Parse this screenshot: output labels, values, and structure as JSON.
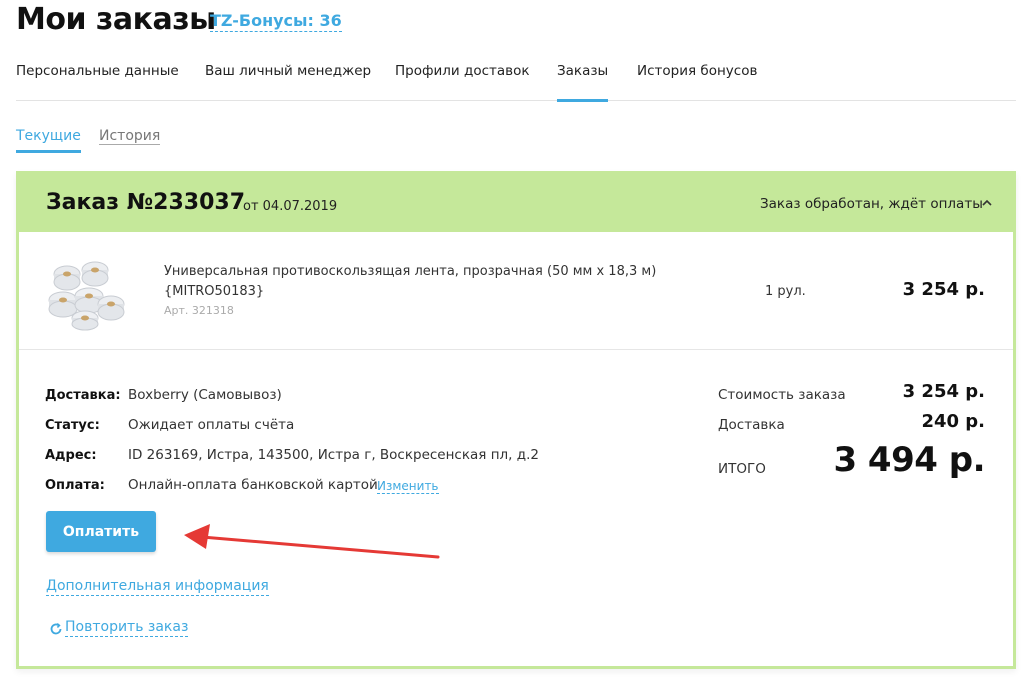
{
  "header": {
    "title": "Мои заказы",
    "bonus_link": "TZ-Бонусы: 36"
  },
  "main_tabs": [
    {
      "label": "Персональные данные"
    },
    {
      "label": "Ваш личный менеджер"
    },
    {
      "label": "Профили доставок"
    },
    {
      "label": "Заказы"
    },
    {
      "label": "История бонусов"
    }
  ],
  "active_main_tab": "Заказы",
  "sub_tabs": [
    {
      "label": "Текущие"
    },
    {
      "label": "История"
    }
  ],
  "active_sub_tab": "Текущие",
  "order": {
    "number": "Заказ №233037",
    "date": "от 04.07.2019",
    "status": "Заказ обработан, ждёт оплаты",
    "item": {
      "name": "Универсальная противоскользящая лента, прозрачная (50 мм х 18,3 м) {MITRO50183}",
      "article": "Арт. 321318",
      "quantity": "1 рул.",
      "price": "3 254 р."
    },
    "details": {
      "delivery_label": "Доставка:",
      "delivery_value": "Boxberry (Самовывоз)",
      "status_label": "Статус:",
      "status_value": "Ожидает оплаты счёта",
      "address_label": "Адрес:",
      "address_value": "ID 263169, Истра, 143500, Истра г, Воскресенская пл, д.2",
      "payment_label": "Оплата:",
      "payment_value": "Онлайн-оплата банковской картой",
      "change_link": "Изменить"
    },
    "pay_button": "Оплатить",
    "extra_info_link": "Дополнительная информация",
    "repeat_link": "Повторить заказ",
    "summary": {
      "cost_label": "Стоимость заказа",
      "cost_value": "3 254 р.",
      "delivery_label": "Доставка",
      "delivery_value": "240 р.",
      "total_label": "ИТОГО",
      "total_value": "3 494 р."
    }
  },
  "colors": {
    "accent": "#3fa9e0",
    "order_header": "#c5e89a",
    "annotation_arrow": "#e53935"
  }
}
